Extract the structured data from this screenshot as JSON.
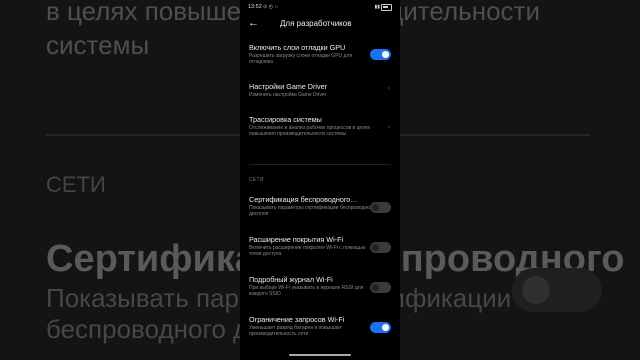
{
  "background": {
    "line1": "в целях повышения производительности",
    "line2": "системы",
    "section": "СЕТИ",
    "big_title": "Сертификация беспроводного",
    "big_sub1": "Показывать параметры сертификации",
    "big_sub2": "беспроводного дисплея"
  },
  "statusbar": {
    "time": "13:52",
    "icons": "⊙ ◴ ∩"
  },
  "appbar": {
    "back_icon": "arrow-left",
    "title": "Для разработчиков"
  },
  "items": [
    {
      "title": "Включить слои отладки GPU",
      "subtitle": "Разрешить загрузку слоев отладки GPU для отладчика",
      "control": "toggle",
      "on": true
    },
    {
      "title": "Настройки Game Driver",
      "subtitle": "Изменить настройки Game Driver",
      "control": "chevron"
    },
    {
      "title": "Трассировка системы",
      "subtitle": "Отслеживание и анализ рабочих процессов в целях повышения производительности системы",
      "control": "chevron"
    },
    {
      "title": "Сертификация беспроводного…",
      "subtitle": "Показывать параметры сертификации беспроводного дисплея",
      "control": "toggle",
      "on": false
    },
    {
      "title": "Расширение покрытия Wi-Fi",
      "subtitle": "Включить расширение покрытия Wi-Fi с помощью точки доступа",
      "control": "toggle",
      "on": false
    },
    {
      "title": "Подробный журнал Wi-Fi",
      "subtitle": "При выборе Wi-Fi указывать в журнале RSSI для каждого SSID",
      "control": "toggle",
      "on": false
    },
    {
      "title": "Ограничение запросов Wi-Fi",
      "subtitle": "Уменьшает разряд батареи и повышает производительность сети",
      "control": "toggle",
      "on": true
    }
  ],
  "section_networks": "СЕТИ",
  "colors": {
    "accent": "#1f6ff2",
    "background": "#000000"
  }
}
